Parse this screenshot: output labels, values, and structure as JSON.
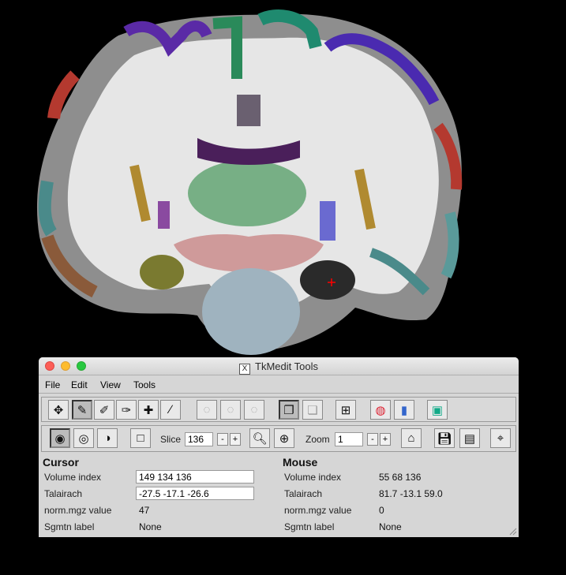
{
  "window": {
    "title": "TkMedit Tools",
    "title_icon": "x11-icon"
  },
  "menu": [
    "File",
    "Edit",
    "View",
    "Tools"
  ],
  "toolbar1": {
    "buttons": [
      "navigate-tool",
      "voxel-edit-tool",
      "recon-edit-tool",
      "roi-edit-tool",
      "ctrl-pt-tool",
      "line-tool",
      "brush-1",
      "brush-2",
      "brush-3",
      "main-view",
      "aux-view",
      "layout-1x1",
      "surface-color",
      "color-scale",
      "save-rgb"
    ]
  },
  "toolbar2": {
    "slice_label": "Slice",
    "slice_value": "136",
    "zoom_label": "Zoom",
    "zoom_value": "1",
    "minus": "-",
    "plus": "+"
  },
  "cursor": {
    "heading": "Cursor",
    "rows": [
      {
        "key": "Volume index",
        "value": "149 134 136"
      },
      {
        "key": "Talairach",
        "value": "-27.5 -17.1 -26.6"
      },
      {
        "key": "norm.mgz value",
        "value": "47"
      },
      {
        "key": "Sgmtn label",
        "value": "None"
      }
    ]
  },
  "mouse": {
    "heading": "Mouse",
    "rows": [
      {
        "key": "Volume index",
        "value": "55 68 136"
      },
      {
        "key": "Talairach",
        "value": "81.7 -13.1 59.0"
      },
      {
        "key": "norm.mgz value",
        "value": "0"
      },
      {
        "key": "Sgmtn label",
        "value": "None"
      }
    ]
  },
  "colors": {
    "cursor_marker": "#ff0000",
    "window_bg": "#d6d6d6"
  }
}
